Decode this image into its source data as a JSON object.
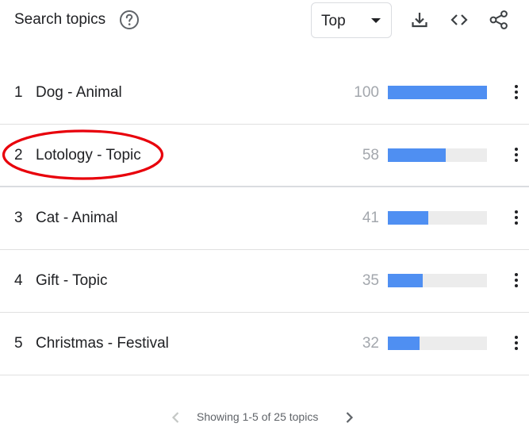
{
  "header": {
    "title": "Search topics",
    "help_icon": "help-circle-icon",
    "select_value": "Top",
    "icons": [
      "download-icon",
      "embed-code-icon",
      "share-icon"
    ]
  },
  "rows": [
    {
      "rank": "1",
      "label": "Dog - Animal",
      "value": "100",
      "fill": 100
    },
    {
      "rank": "2",
      "label": "Lotology - Topic",
      "value": "58",
      "fill": 58,
      "highlighted": true
    },
    {
      "rank": "3",
      "label": "Cat - Animal",
      "value": "41",
      "fill": 41
    },
    {
      "rank": "4",
      "label": "Gift - Topic",
      "value": "35",
      "fill": 35
    },
    {
      "rank": "5",
      "label": "Christmas - Festival",
      "value": "32",
      "fill": 32
    }
  ],
  "pager": {
    "text": "Showing 1-5 of 25 topics",
    "prev_icon": "chevron-left-icon",
    "next_icon": "chevron-right-icon"
  },
  "colors": {
    "bar_fill": "#4f8ff2",
    "bar_track": "#ececec",
    "annotation": "#e8000b"
  }
}
